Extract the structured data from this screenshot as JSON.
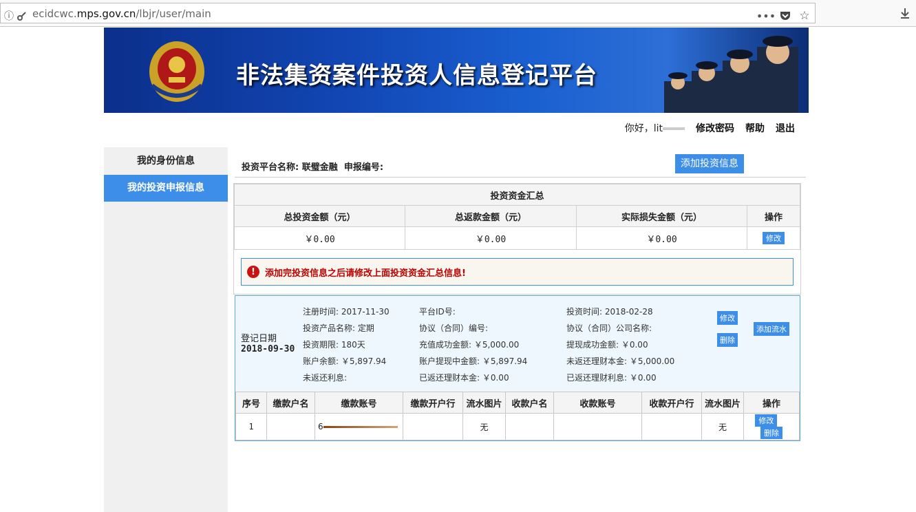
{
  "browser": {
    "url_prefix": "ecidcwc.",
    "url_domain": "mps.gov.cn",
    "url_path": "/lbjr/user/main",
    "icons": [
      "info-icon",
      "key-icon",
      "more-icon",
      "pocket-icon",
      "star-icon",
      "download-icon"
    ]
  },
  "banner": {
    "title": "非法集资案件投资人信息登记平台"
  },
  "userbar": {
    "greeting": "你好，lit",
    "change_password": "修改密码",
    "help": "帮助",
    "logout": "退出"
  },
  "sidebar": {
    "items": [
      {
        "label": "我的身份信息",
        "active": false
      },
      {
        "label": "我的投资申报信息",
        "active": true
      }
    ]
  },
  "main": {
    "platform_label": "投资平台名称:",
    "platform_name": "联璧金融",
    "report_no_label": "申报编号:",
    "add_button": "添加投资信息"
  },
  "summary": {
    "title": "投资资金汇总",
    "headers": [
      "总投资金额（元）",
      "总返款金额（元）",
      "实际损失金额（元）",
      "操作"
    ],
    "values": [
      "￥0.00",
      "￥0.00",
      "￥0.00"
    ],
    "edit_button": "修改",
    "alert_text": "添加完投资信息之后请修改上面投资资金汇总信息!"
  },
  "record": {
    "reg_date_label": "登记日期",
    "reg_date": "2018-09-30",
    "fields": {
      "reg_time": "注册时间: 2017-11-30",
      "platform_id": "平台ID号:",
      "invest_time": "投资时间: 2018-02-28",
      "product_name": "投资产品名称: 定期",
      "contract_no": "协议（合同）编号:",
      "contract_company": "协议（合同）公司名称:",
      "term": "投资期限: 180天",
      "recharge": "充值成功金额: ￥5,000.00",
      "withdraw": "提现成功金额: ￥0.00",
      "balance": "账户余额:  ￥5,897.94",
      "withdrawing": "账户提现中金额:  ￥5,897.94",
      "unreturned_principal": "未返还理财本金:  ￥5,000.00",
      "unreturned_interest": "未返还利息:",
      "returned_principal": "已返还理财本金: ￥0.00",
      "returned_interest": "已返还理财利息:  ￥0.00"
    },
    "edit_button": "修改",
    "delete_button": "删除",
    "add_flow_button": "添加流水"
  },
  "flow_table": {
    "headers": [
      "序号",
      "缴款户名",
      "缴款账号",
      "缴款开户行",
      "流水图片",
      "收款户名",
      "收款账号",
      "收款开户行",
      "流水图片",
      "操作"
    ],
    "rows": [
      {
        "index": "1",
        "payer_account_prefix": "6",
        "payer_image": "无",
        "payee_image": "无",
        "edit": "修改",
        "delete": "删除"
      }
    ]
  }
}
